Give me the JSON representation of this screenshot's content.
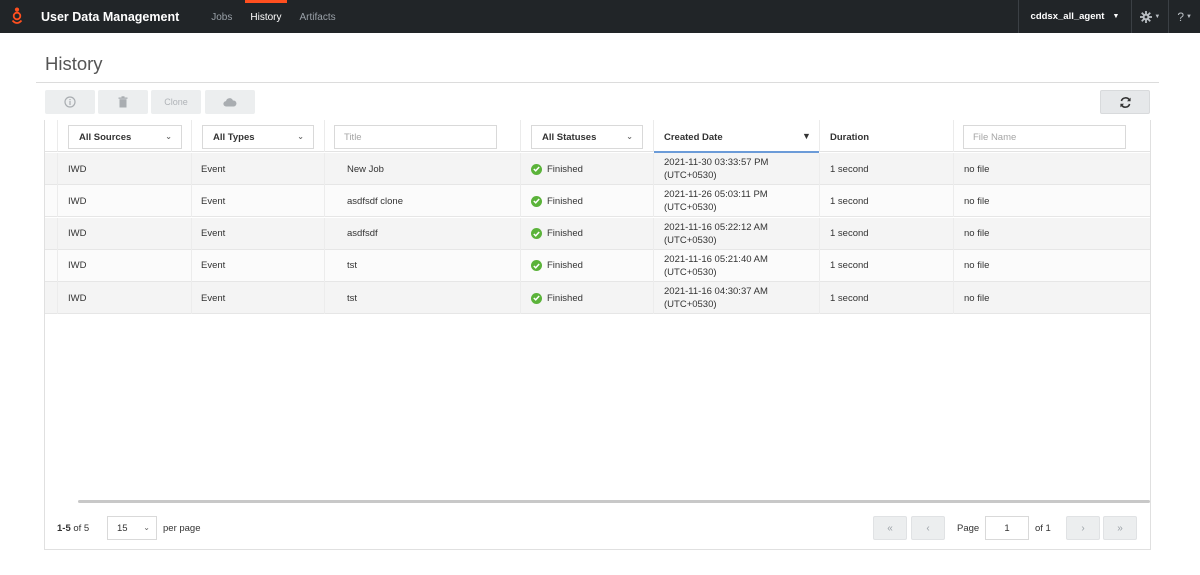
{
  "app": {
    "title": "User Data Management",
    "tabs": [
      {
        "label": "Jobs",
        "active": false
      },
      {
        "label": "History",
        "active": true
      },
      {
        "label": "Artifacts",
        "active": false
      }
    ],
    "user": "cddsx_all_agent",
    "help": "?",
    "accent_color": "#ff4f1f"
  },
  "page": {
    "title": "History"
  },
  "toolbar": {
    "info_icon": "info-circle-icon",
    "delete_icon": "trash-icon",
    "clone_label": "Clone",
    "cloud_icon": "cloud-icon",
    "refresh_icon": "refresh-icon"
  },
  "filters": {
    "source": "All Sources",
    "type": "All Types",
    "title_placeholder": "Title",
    "status": "All Statuses",
    "created_date": "Created Date",
    "duration": "Duration",
    "file_name_placeholder": "File Name"
  },
  "rows": [
    {
      "source": "IWD",
      "type": "Event",
      "title": "New Job",
      "status": "Finished",
      "date": "2021-11-30 03:33:57 PM",
      "tz": "(UTC+0530)",
      "duration": "1 second",
      "file": "no file"
    },
    {
      "source": "IWD",
      "type": "Event",
      "title": "asdfsdf clone",
      "status": "Finished",
      "date": "2021-11-26 05:03:11 PM",
      "tz": "(UTC+0530)",
      "duration": "1 second",
      "file": "no file"
    },
    {
      "source": "IWD",
      "type": "Event",
      "title": "asdfsdf",
      "status": "Finished",
      "date": "2021-11-16 05:22:12 AM",
      "tz": "(UTC+0530)",
      "duration": "1 second",
      "file": "no file"
    },
    {
      "source": "IWD",
      "type": "Event",
      "title": "tst",
      "status": "Finished",
      "date": "2021-11-16 05:21:40 AM",
      "tz": "(UTC+0530)",
      "duration": "1 second",
      "file": "no file"
    },
    {
      "source": "IWD",
      "type": "Event",
      "title": "tst",
      "status": "Finished",
      "date": "2021-11-16 04:30:37 AM",
      "tz": "(UTC+0530)",
      "duration": "1 second",
      "file": "no file"
    }
  ],
  "status_color": "#5bb33a",
  "pagination": {
    "range": "1-5",
    "of_total": "of 5",
    "per_page": "15",
    "per_page_label": "per page",
    "page_label": "Page",
    "current_page": "1",
    "of_pages": "of 1",
    "first": "«",
    "prev": "‹",
    "next": "›",
    "last": "»"
  }
}
